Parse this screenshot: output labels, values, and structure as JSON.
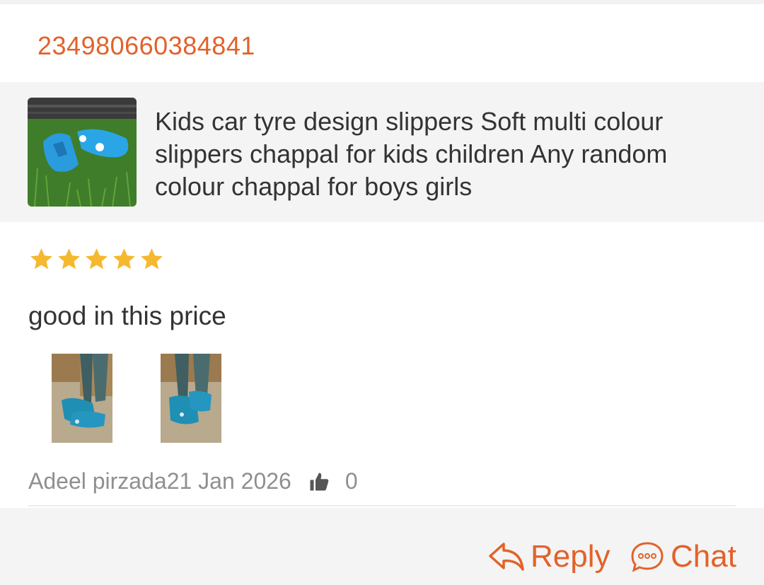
{
  "order": {
    "id": "234980660384841"
  },
  "product": {
    "title": "Kids car tyre design slippers  Soft multi colour slippers chappal for kids children  Any random colour chappal for boys girls",
    "thumbnail_icon": "slipper-product-photo"
  },
  "review": {
    "rating": 5,
    "rating_max": 5,
    "star_color": "#f5b82e",
    "text": "good in this price",
    "photos": [
      "review-photo-1",
      "review-photo-2"
    ],
    "author": "Adeel pirzada",
    "date": "21 Jan 2026",
    "like_icon": "thumbs-up-icon",
    "like_count": "0"
  },
  "actions": {
    "reply_label": "Reply",
    "reply_icon": "reply-arrow-icon",
    "chat_label": "Chat",
    "chat_icon": "chat-bubble-icon"
  },
  "colors": {
    "accent": "#e2622a",
    "text": "#333333",
    "muted": "#8f8f8f",
    "panel": "#f4f4f4"
  }
}
